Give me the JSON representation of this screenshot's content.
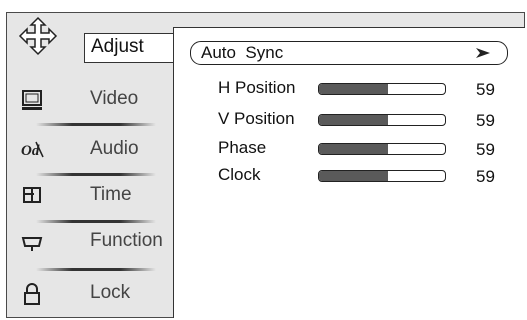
{
  "sidebar": {
    "active": {
      "label": "Adjust",
      "icon": "four-way-arrow-icon"
    },
    "items": [
      {
        "label": "Video",
        "icon": "monitor-icon"
      },
      {
        "label": "Audio",
        "icon": "audio-icon"
      },
      {
        "label": "Time",
        "icon": "clock-icon"
      },
      {
        "label": "Function",
        "icon": "function-icon"
      },
      {
        "label": "Lock",
        "icon": "lock-icon"
      }
    ]
  },
  "adjust": {
    "auto_sync": {
      "label": "Auto  Sync",
      "icon": "right-arrow-icon"
    },
    "rows": [
      {
        "label": "H Position",
        "value": "59",
        "fill_fraction": 0.55
      },
      {
        "label": "V Position",
        "value": "59",
        "fill_fraction": 0.55
      },
      {
        "label": "Phase",
        "value": "59",
        "fill_fraction": 0.55
      },
      {
        "label": "Clock",
        "value": "59",
        "fill_fraction": 0.55
      }
    ]
  },
  "colors": {
    "frame": "#e6e6e6",
    "panel": "#ffffff",
    "bar_fill": "#5a5a5a",
    "text": "#444444"
  }
}
